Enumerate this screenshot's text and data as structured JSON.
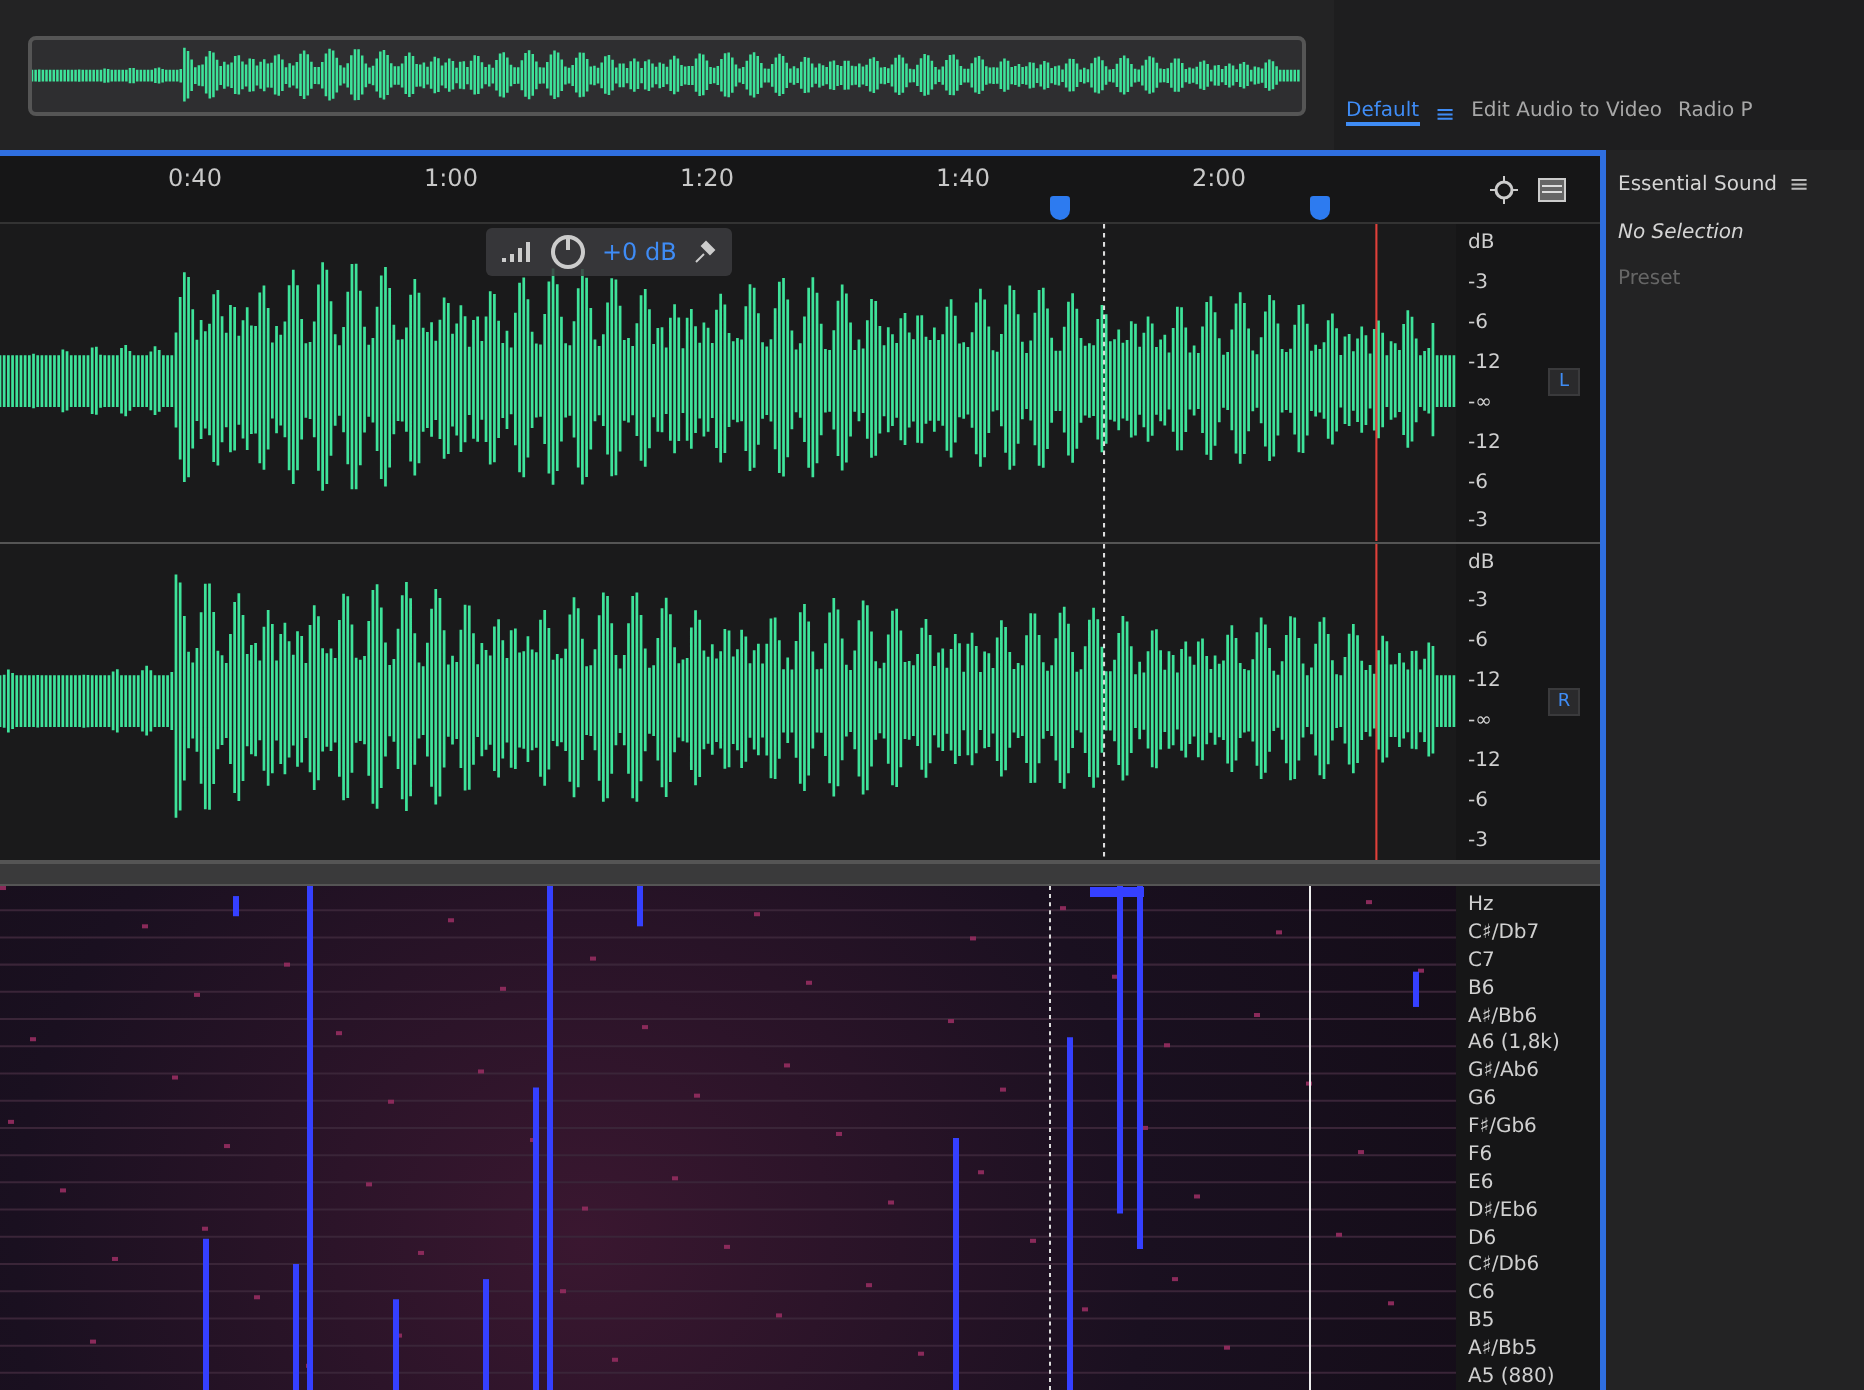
{
  "workspace": {
    "menu_icon": "≡",
    "tabs": [
      {
        "label": "Default",
        "selected": true
      },
      {
        "label": "Edit Audio to Video",
        "selected": false
      },
      {
        "label": "Radio P",
        "selected": false
      }
    ]
  },
  "time_ruler": {
    "ticks": [
      "0:40",
      "1:00",
      "1:20",
      "1:40",
      "2:00"
    ]
  },
  "hud": {
    "gain": "+0 dB"
  },
  "channels": [
    {
      "badge": "L",
      "scale": [
        "dB",
        "-3",
        "-6",
        "-12",
        "-∞",
        "-12",
        "-6",
        "-3"
      ]
    },
    {
      "badge": "R",
      "scale": [
        "dB",
        "-3",
        "-6",
        "-12",
        "-∞",
        "-12",
        "-6",
        "-3"
      ]
    }
  ],
  "spectral": {
    "scale": [
      "Hz",
      "C♯/Db7",
      "C7",
      "B6",
      "A♯/Bb6",
      "A6 (1,8k)",
      "G♯/Ab6",
      "G6",
      "F♯/Gb6",
      "F6",
      "E6",
      "D♯/Eb6",
      "D6",
      "C♯/Db6",
      "C6",
      "B5",
      "A♯/Bb5",
      "A5 (880)"
    ]
  },
  "essential_sound": {
    "title": "Essential Sound",
    "menu_icon": "≡",
    "status": "No Selection",
    "preset_label": "Preset"
  }
}
